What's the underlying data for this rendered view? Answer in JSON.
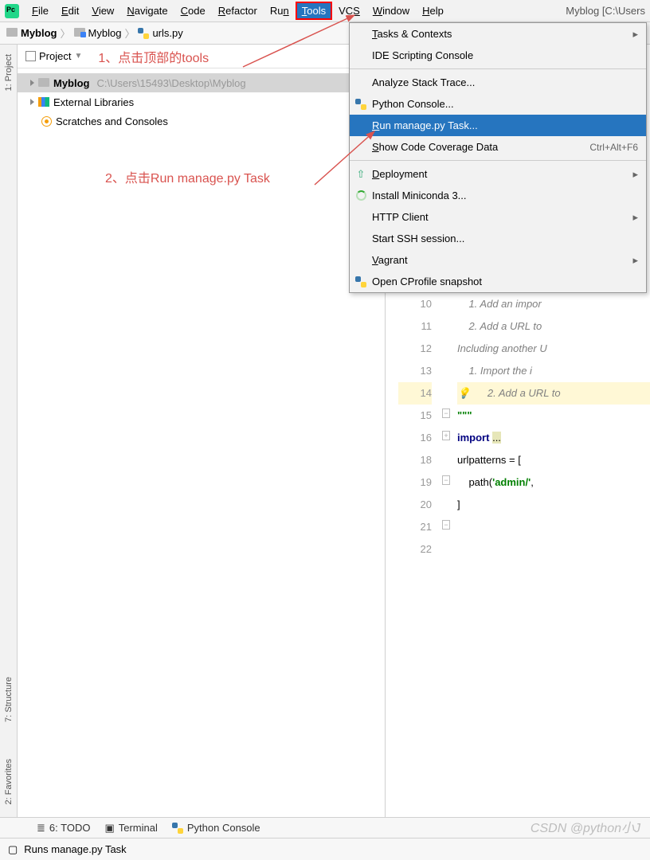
{
  "menubar": {
    "items": [
      {
        "l": "F",
        "r": "ile"
      },
      {
        "l": "E",
        "r": "dit"
      },
      {
        "l": "V",
        "r": "iew"
      },
      {
        "l": "N",
        "r": "avigate"
      },
      {
        "l": "C",
        "r": "ode"
      },
      {
        "l": "R",
        "r": "efactor"
      },
      {
        "l": "",
        "r": "Ru",
        "t": "n"
      },
      {
        "l": "T",
        "r": "ools",
        "active": true
      },
      {
        "l": "",
        "r": "VC",
        "t": "S"
      },
      {
        "l": "W",
        "r": "indow"
      },
      {
        "l": "H",
        "r": "elp"
      }
    ],
    "title": "Myblog [C:\\Users"
  },
  "breadcrumb": {
    "p1": "Myblog",
    "p2": "Myblog",
    "p3": "urls.py"
  },
  "projectPane": {
    "title": "Project",
    "annot1": "1、点击顶部的tools",
    "annot2": "2、点击Run manage.py Task",
    "tree": {
      "root": "Myblog",
      "rootPath": "C:\\Users\\15493\\Desktop\\Myblog",
      "ext": "External Libraries",
      "scr": "Scratches and Consoles"
    }
  },
  "sidebar": {
    "tab1": "1: Project",
    "tab2": "7: Structure",
    "tab3": "2: Favorites"
  },
  "dropdown": {
    "items": [
      {
        "label": "Tasks & Contexts",
        "sub": true,
        "u": "T"
      },
      {
        "label": "IDE Scripting Console"
      },
      {
        "sep": true
      },
      {
        "label": "Analyze Stack Trace..."
      },
      {
        "label": "Python Console...",
        "ico": "py"
      },
      {
        "label": "Run manage.py Task...",
        "sel": true,
        "u": "R"
      },
      {
        "label": "Show Code Coverage Data",
        "short": "Ctrl+Alt+F6",
        "u": "S"
      },
      {
        "sep": true
      },
      {
        "label": "Deployment",
        "sub": true,
        "ico": "dep",
        "u": "D"
      },
      {
        "label": "Install Miniconda 3...",
        "ico": "spin"
      },
      {
        "label": "HTTP Client",
        "sub": true
      },
      {
        "label": "Start SSH session..."
      },
      {
        "label": "Vagrant",
        "sub": true,
        "u": "V"
      },
      {
        "label": "Open CProfile snapshot",
        "ico": "py"
      }
    ]
  },
  "editor": {
    "lines": [
      {
        "n": 10,
        "cm": "    1. Add an impor"
      },
      {
        "n": 11,
        "cm": "    2. Add a URL to"
      },
      {
        "n": 12,
        "cm": "Including another U"
      },
      {
        "n": 13,
        "cm": "    1. Import the i"
      },
      {
        "n": 14,
        "cm": "    2. Add a URL to",
        "bulb": true,
        "hl": true
      },
      {
        "n": 15,
        "raw": "\"\"\"",
        "cls": "st",
        "fold": "-"
      },
      {
        "n": 16,
        "raw": "import ...",
        "hl2": true,
        "fold": "+"
      },
      {
        "n": 18,
        "raw": ""
      },
      {
        "n": 19,
        "raw": "urlpatterns = [",
        "fold": "-"
      },
      {
        "n": 20,
        "raw": "    path('admin/',"
      },
      {
        "n": 21,
        "raw": "]",
        "fold": "-"
      },
      {
        "n": 22,
        "raw": ""
      }
    ]
  },
  "bottom": {
    "todo": "6: TODO",
    "term": "Terminal",
    "pyc": "Python Console"
  },
  "status": {
    "text": "Runs manage.py Task"
  },
  "watermark": "CSDN @python小J"
}
